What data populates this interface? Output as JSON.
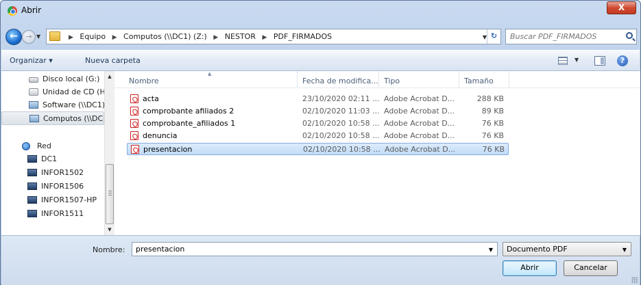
{
  "window": {
    "title": "Abrir",
    "close_label": "X"
  },
  "address": {
    "crumbs": [
      "Equipo",
      "Computos (\\\\DC1) (Z:)",
      "NESTOR",
      "PDF_FIRMADOS"
    ],
    "search_placeholder": "Buscar PDF_FIRMADOS"
  },
  "toolbar": {
    "organize_label": "Organizar ▾",
    "new_folder_label": "Nueva carpeta"
  },
  "nav": {
    "items": [
      {
        "label": "Disco local (G:)",
        "icon": "drive-icon"
      },
      {
        "label": "Unidad de CD (H",
        "icon": "cd-drive-icon"
      },
      {
        "label": "Software (\\\\DC1)",
        "icon": "network-drive-icon"
      },
      {
        "label": "Computos (\\\\DC",
        "icon": "network-drive-icon",
        "selected": true
      },
      {
        "label": "Red",
        "icon": "network-icon"
      },
      {
        "label": "DC1",
        "icon": "computer-icon"
      },
      {
        "label": "INFOR1502",
        "icon": "computer-icon"
      },
      {
        "label": "INFOR1506",
        "icon": "computer-icon"
      },
      {
        "label": "INFOR1507-HP",
        "icon": "computer-icon"
      },
      {
        "label": "INFOR1511",
        "icon": "computer-icon"
      }
    ]
  },
  "files": {
    "columns": [
      "Nombre",
      "Fecha de modifica...",
      "Tipo",
      "Tamaño"
    ],
    "rows": [
      {
        "name": "acta",
        "date": "23/10/2020 02:11 ...",
        "type": "Adobe Acrobat D...",
        "size": "288 KB"
      },
      {
        "name": "comprobante afiliados 2",
        "date": "02/10/2020 11:03 ...",
        "type": "Adobe Acrobat D...",
        "size": "89 KB"
      },
      {
        "name": "comprobante_afiliados 1",
        "date": "02/10/2020 10:58 ...",
        "type": "Adobe Acrobat D...",
        "size": "76 KB"
      },
      {
        "name": "denuncia",
        "date": "02/10/2020 10:58 ...",
        "type": "Adobe Acrobat D...",
        "size": "76 KB"
      },
      {
        "name": "presentacion",
        "date": "02/10/2020 10:58 ...",
        "type": "Adobe Acrobat D...",
        "size": "76 KB",
        "selected": true
      }
    ]
  },
  "bottom": {
    "name_label": "Nombre:",
    "name_value": "presentacion",
    "type_value": "Documento PDF",
    "open_label": "Abrir",
    "cancel_label": "Cancelar"
  },
  "colors": {
    "selection": "#c2dcf7",
    "pdf_red": "#d01f1f",
    "titlebar": "#b7cde8"
  }
}
